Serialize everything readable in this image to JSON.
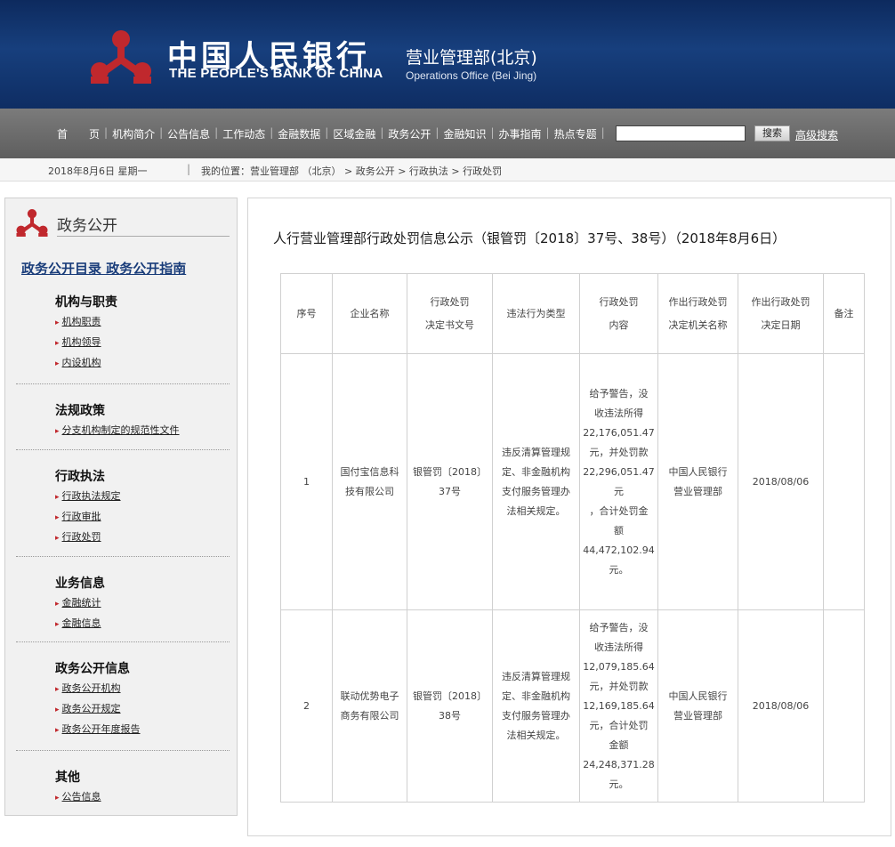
{
  "header": {
    "cn_name": "中国人民银行",
    "en_name": "THE PEOPLE'S BANK OF CHINA",
    "office_cn": "营业管理部(北京)",
    "office_en": "Operations Office (Bei Jing)",
    "logo_icon": "pboc-logo-icon",
    "logo_color": "#c0282d"
  },
  "nav": {
    "items": [
      "首　　页",
      "机构简介",
      "公告信息",
      "工作动态",
      "金融数据",
      "区域金融",
      "政务公开",
      "金融知识",
      "办事指南",
      "热点专题"
    ],
    "search_button": "搜索",
    "advanced_search": "高级搜索"
  },
  "breadcrumb": {
    "date": "2018年8月6日  星期一",
    "path": "我的位置：营业管理部  （北京）  >  政务公开  >  行政执法  >  行政处罚"
  },
  "sidebar": {
    "title": "政务公开",
    "top_links": "政务公开目录  政务公开指南",
    "sections": [
      {
        "title": "机构与职责",
        "links": [
          "机构职责",
          "机构领导",
          "内设机构"
        ]
      },
      {
        "title": "法规政策",
        "links": [
          "分支机构制定的规范性文件"
        ]
      },
      {
        "title": "行政执法",
        "links": [
          "行政执法规定",
          "行政审批",
          "行政处罚"
        ]
      },
      {
        "title": "业务信息",
        "links": [
          "金融统计",
          "金融信息"
        ]
      },
      {
        "title": "政务公开信息",
        "links": [
          "政务公开机构",
          "政务公开规定",
          "政务公开年度报告"
        ]
      },
      {
        "title": "其他",
        "links": [
          "公告信息"
        ]
      }
    ]
  },
  "main": {
    "title": "人行营业管理部行政处罚信息公示（银管罚〔2018〕37号、38号）（2018年8月6日）",
    "table": {
      "headers": [
        [
          "序号"
        ],
        [
          "企业名称"
        ],
        [
          "行政处罚",
          "决定书文号"
        ],
        [
          "违法行为类型"
        ],
        [
          "行政处罚",
          "内容"
        ],
        [
          "作出行政处罚",
          "决定机关名称"
        ],
        [
          "作出行政处罚",
          "决定日期"
        ],
        [
          "备注"
        ]
      ],
      "rows": [
        {
          "no": "1",
          "company": [
            "国付宝信息科",
            "技有限公司"
          ],
          "doc_no": [
            "银管罚〔2018〕",
            "37号"
          ],
          "violation": [
            "违反清算管理规",
            "定、非金融机构",
            "支付服务管理办",
            "法相关规定。"
          ],
          "content": [
            "给予警告，没",
            "收违法所得",
            "22,176,051.47",
            "元，并处罚款",
            "22,296,051.47",
            "元",
            "，合计处罚金",
            "额",
            "44,472,102.94",
            "元。"
          ],
          "authority": [
            "中国人民银行",
            "营业管理部"
          ],
          "date": "2018/08/06",
          "remark": ""
        },
        {
          "no": "2",
          "company": [
            "联动优势电子",
            "商务有限公司"
          ],
          "doc_no": [
            "银管罚〔2018〕",
            "38号"
          ],
          "violation": [
            "违反清算管理规",
            "定、非金融机构",
            "支付服务管理办",
            "法相关规定。"
          ],
          "content": [
            "给予警告，没",
            "收违法所得",
            "12,079,185.64",
            "元，并处罚款",
            "12,169,185.64",
            "元，合计处罚",
            "金额",
            "24,248,371.28",
            "元。"
          ],
          "authority": [
            "中国人民银行",
            "营业管理部"
          ],
          "date": "2018/08/06",
          "remark": ""
        }
      ]
    }
  }
}
